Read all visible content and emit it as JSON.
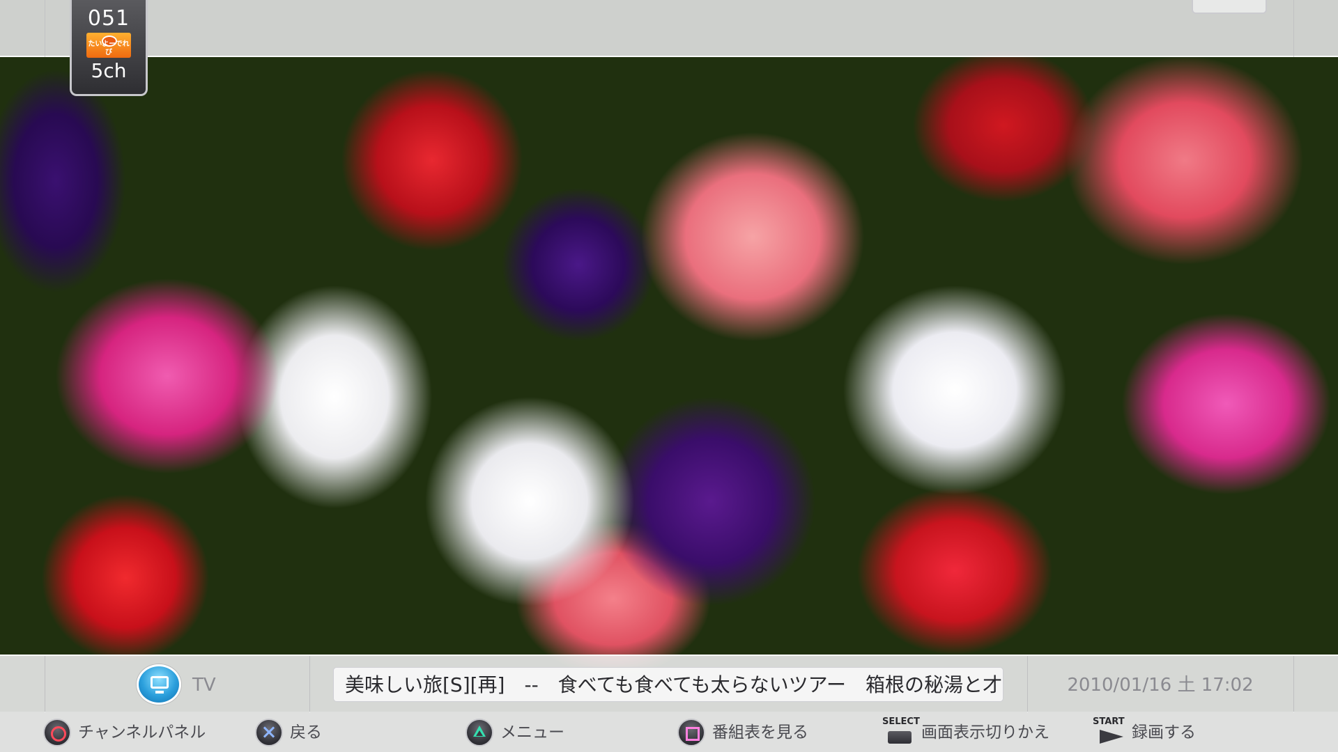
{
  "channel": {
    "number": "051",
    "name": "5ch",
    "logo_text": "たいよーでれび"
  },
  "info_bar": {
    "source_label": "TV",
    "program_title": "美味しい旅[S][再]　--　食べても食べても太らないツアー　箱根の秘湯と才",
    "datetime": "2010/01/16 土 17:02"
  },
  "controls": [
    {
      "symbol": "circle",
      "label": "チャンネルパネル"
    },
    {
      "symbol": "cross",
      "label": "戻る"
    },
    {
      "symbol": "triangle",
      "label": "メニュー"
    },
    {
      "symbol": "square",
      "label": "番組表を見る"
    },
    {
      "symbol": "select",
      "key_text": "SELECT",
      "label": "画面表示切りかえ"
    },
    {
      "symbol": "start",
      "key_text": "START",
      "label": "録画する"
    }
  ],
  "colors": {
    "circle": "#ff4a5a",
    "cross": "#8fb6ff",
    "triangle": "#34e0b0",
    "square": "#ff80e0"
  },
  "icons": {
    "source": "tv-monitor-icon",
    "channel_logo": "sun-mascot-icon"
  }
}
